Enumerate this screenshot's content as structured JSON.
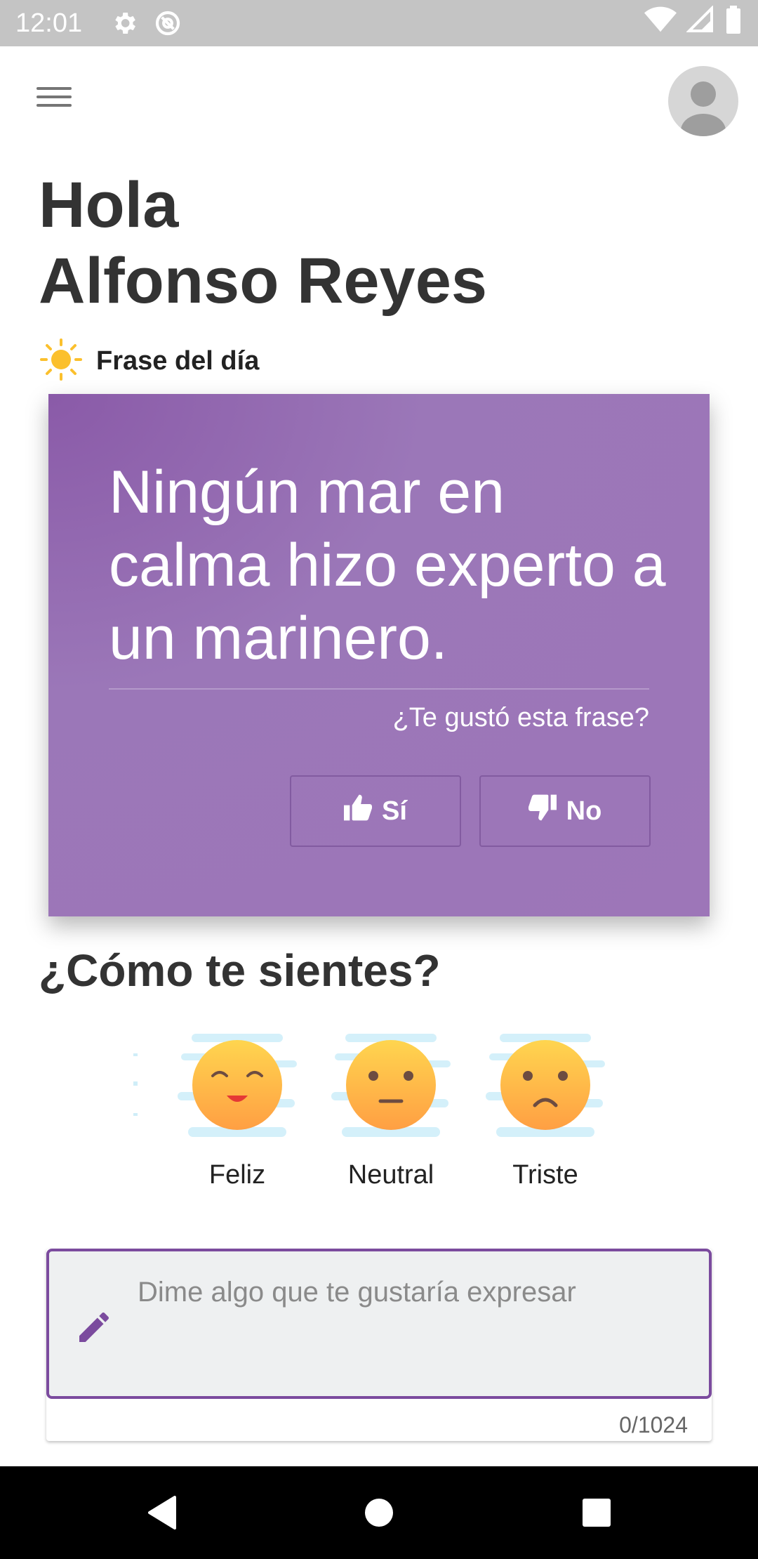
{
  "status_bar": {
    "time": "12:01",
    "icons": [
      "settings-icon",
      "at-sign-icon",
      "wifi-icon",
      "signal-icon",
      "battery-icon"
    ]
  },
  "header": {
    "menu_icon": "hamburger-menu-icon",
    "avatar_icon": "user-avatar-icon"
  },
  "greeting": {
    "line1": "Hola",
    "line2": "Alfonso Reyes"
  },
  "daily_quote": {
    "section_label": "Frase del día",
    "section_icon": "sun-icon",
    "text": "Ningún mar en calma hizo experto a un marinero.",
    "question": "¿Te gustó esta frase?",
    "yes_label": "Sí",
    "no_label": "No",
    "card_color": "#9d76b8"
  },
  "mood": {
    "title": "¿Cómo te sientes?",
    "options": [
      {
        "label": "Feliz",
        "icon": "happy-face-icon"
      },
      {
        "label": "Neutral",
        "icon": "neutral-face-icon"
      },
      {
        "label": "Triste",
        "icon": "sad-face-icon"
      }
    ]
  },
  "expression_input": {
    "placeholder": "Dime algo que te gustaría expresar",
    "value": "",
    "counter": "0/1024",
    "icon": "pencil-icon",
    "accent_color": "#7b4b9e"
  },
  "nav_bar": {
    "buttons": [
      "back-icon",
      "home-icon",
      "recents-icon"
    ]
  }
}
